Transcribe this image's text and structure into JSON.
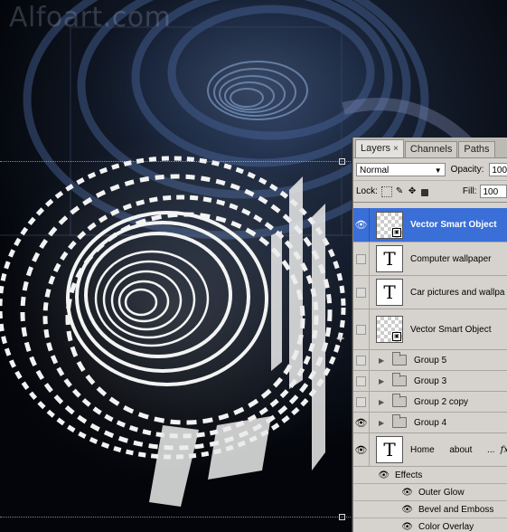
{
  "watermark": "Alfoart.com",
  "panel": {
    "tabs": [
      {
        "label": "Layers",
        "close": "×"
      },
      {
        "label": "Channels"
      },
      {
        "label": "Paths"
      }
    ],
    "blend_mode": "Normal",
    "opacity_label": "Opacity:",
    "opacity_value": "100",
    "lock_label": "Lock:",
    "fill_label": "Fill:",
    "fill_value": "100"
  },
  "layers": [
    {
      "name": "Vector Smart Object",
      "type": "smart",
      "visible": true,
      "selected": true
    },
    {
      "name": "Computer wallpaper",
      "type": "text",
      "visible": false
    },
    {
      "name": "Car pictures and wallpa",
      "type": "text",
      "visible": false
    },
    {
      "name": "Vector Smart Object",
      "type": "smart",
      "visible": false
    },
    {
      "name": "Group 5",
      "type": "group",
      "visible": false
    },
    {
      "name": "Group 3",
      "type": "group",
      "visible": false
    },
    {
      "name": "Group 2 copy",
      "type": "group",
      "visible": false
    },
    {
      "name": "Group 4",
      "type": "group",
      "visible": true
    },
    {
      "name": "Home      about      ...",
      "type": "text",
      "visible": true,
      "fx": "fx"
    }
  ],
  "effects": {
    "title": "Effects",
    "items": [
      "Outer Glow",
      "Bevel and Emboss",
      "Color Overlay"
    ]
  },
  "icons": {
    "visibility": "eye-icon",
    "smart_object": "smart-object-badge-icon",
    "folder": "folder-icon",
    "expand": "triangle-right-icon"
  },
  "colors": {
    "selection": "#3a6fd8",
    "panel_bg": "#d6d3ce",
    "canvas_bg": "#05070c"
  }
}
